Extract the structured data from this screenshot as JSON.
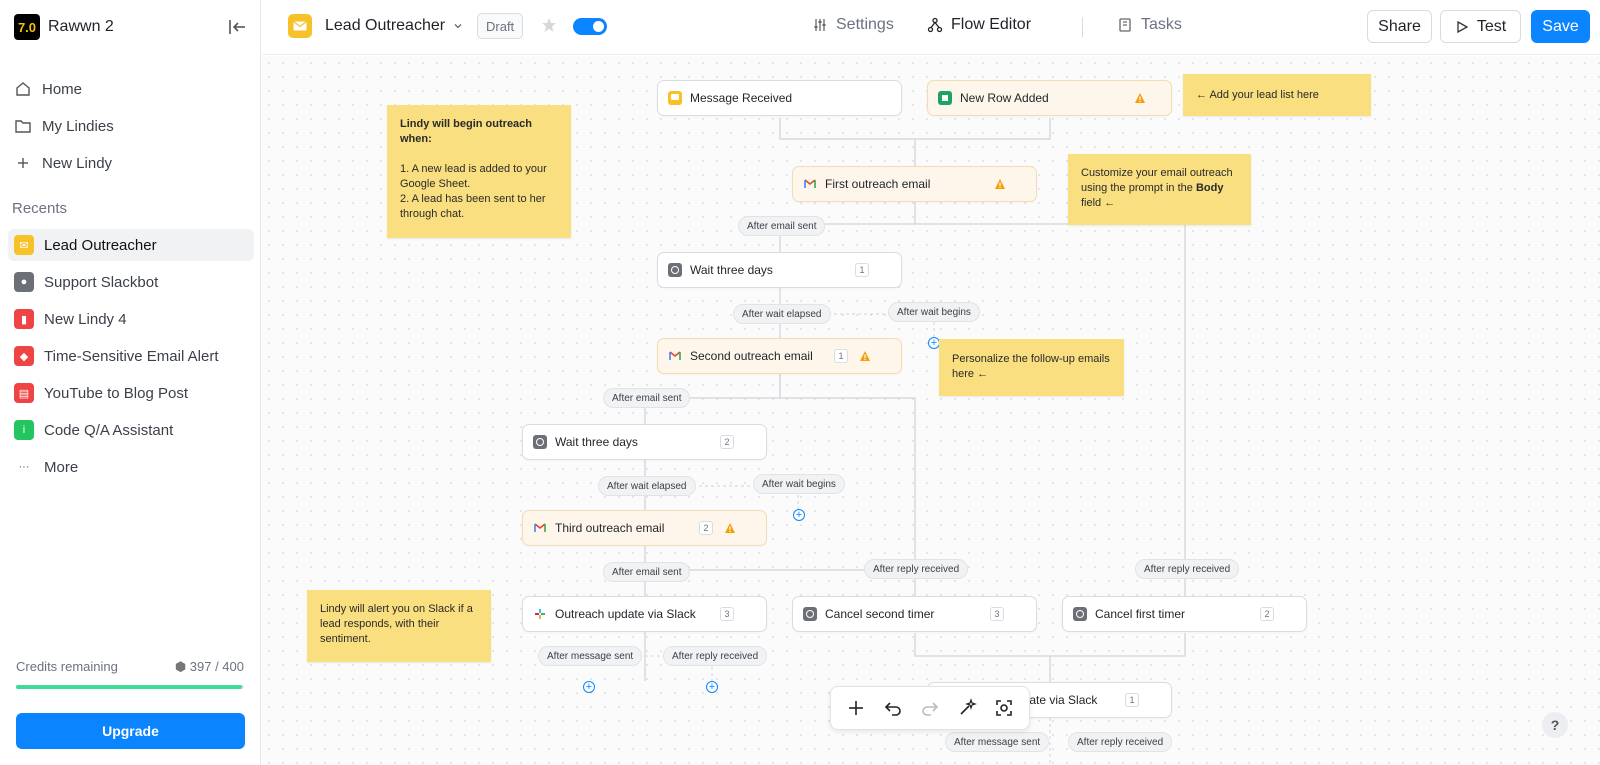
{
  "workspace": {
    "name": "Rawwn 2",
    "logo_text": "7.0"
  },
  "nav": {
    "home": "Home",
    "my_lindies": "My Lindies",
    "new_lindy": "New Lindy"
  },
  "recents": {
    "title": "Recents",
    "items": [
      {
        "label": "Lead Outreacher",
        "color": "#f7c12a",
        "icon": "mail-icon"
      },
      {
        "label": "Support Slackbot",
        "color": "#6b6f76",
        "icon": "chat-icon"
      },
      {
        "label": "New Lindy 4",
        "color": "#ef4444",
        "icon": "chart-icon"
      },
      {
        "label": "Time-Sensitive Email Alert",
        "color": "#ef4444",
        "icon": "bell-icon"
      },
      {
        "label": "YouTube to Blog Post",
        "color": "#ef4444",
        "icon": "doc-icon"
      },
      {
        "label": "Code Q/A Assistant",
        "color": "#22c55e",
        "icon": "info-icon"
      }
    ],
    "more": "More"
  },
  "credits": {
    "label": "Credits remaining",
    "value": "397 / 400",
    "fraction": 0.9925
  },
  "upgrade_label": "Upgrade",
  "header": {
    "flow_name": "Lead Outreacher",
    "status": "Draft",
    "tabs": {
      "settings": "Settings",
      "flow_editor": "Flow Editor",
      "tasks": "Tasks"
    },
    "share": "Share",
    "test": "Test",
    "save": "Save"
  },
  "nodes": {
    "message_received": "Message Received",
    "new_row_added": "New Row Added",
    "first_email": "First outreach email",
    "wait1": {
      "label": "Wait three days",
      "count": "1"
    },
    "second_email": {
      "label": "Second outreach email",
      "count": "1"
    },
    "wait2": {
      "label": "Wait three days",
      "count": "2"
    },
    "third_email": {
      "label": "Third outreach email",
      "count": "2"
    },
    "outreach_slack": {
      "label": "Outreach update via Slack",
      "count": "3"
    },
    "cancel_second": {
      "label": "Cancel second timer",
      "count": "3"
    },
    "cancel_first": {
      "label": "Cancel first timer",
      "count": "2"
    },
    "update_slack": {
      "label": "pdate via Slack",
      "count": "1"
    }
  },
  "edges": {
    "after_email_sent_1": "After email sent",
    "after_wait_elapsed_1": "After wait elapsed",
    "after_wait_begins_1": "After wait begins",
    "after_email_sent_2": "After email sent",
    "after_wait_elapsed_2": "After wait elapsed",
    "after_wait_begins_2": "After wait begins",
    "after_email_sent_3": "After email sent",
    "after_reply_received_1": "After reply received",
    "after_reply_received_2": "After reply received",
    "after_message_sent_1": "After message sent",
    "after_reply_received_3": "After reply received",
    "after_message_sent_2": "After message sent",
    "after_reply_received_4": "After reply received"
  },
  "notes": {
    "add_lead_list": "← Add your lead list here",
    "begin_title": "Lindy will begin outreach when:",
    "begin_item1": "1. A new lead is added to your Google Sheet.",
    "begin_item2": "2. A lead has been sent to her through chat.",
    "customize_pre": "Customize your email outreach using the prompt in the",
    "customize_bold": "Body",
    "customize_post": "field ←",
    "personalize": "Personalize the follow-up emails here ←",
    "slack_alert": "Lindy will alert you on Slack if a lead responds, with their sentiment."
  },
  "help_label": "?",
  "colors": {
    "accent": "#0a84ff",
    "note": "#f9df7f",
    "warning": "#f59e0b",
    "credits_bar": "#3ddc97"
  }
}
